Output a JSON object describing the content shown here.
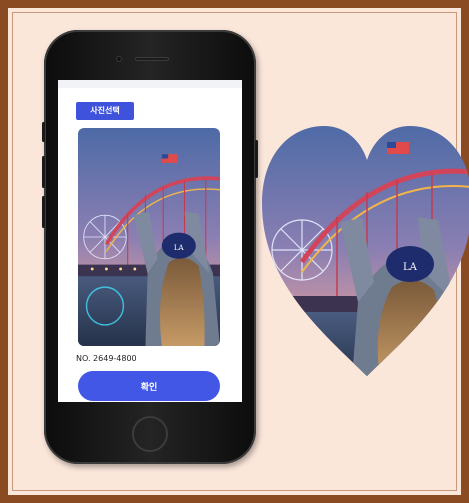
{
  "app": {
    "select_photo_label": "사진선택",
    "photo_number": "NO. 2649-4800",
    "confirm_label": "확인"
  },
  "colors": {
    "frame_border": "#8a4a22",
    "background": "#fbe6da",
    "accent_button": "#4357e6"
  },
  "icons": {
    "home_button": "home-button-circle",
    "speaker": "speaker-grille"
  }
}
